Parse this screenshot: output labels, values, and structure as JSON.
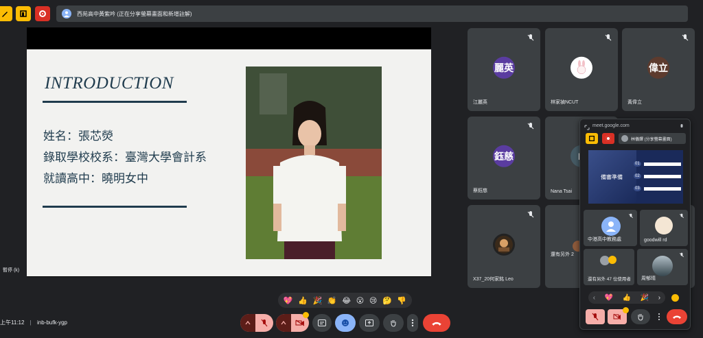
{
  "topbar": {
    "presenting_text": "西苑高中黃紫吟 (正在分享螢幕畫面和新增註解)"
  },
  "slide": {
    "title": "INTRODUCTION",
    "lines": [
      "姓名：張芯熒",
      "錄取學校校系：臺灣大學會計系",
      "就讀高中：曉明女中"
    ]
  },
  "tiles": [
    {
      "name": "江麗英",
      "avatar_text": "麗英",
      "avatar_color": "#5a3ca0"
    },
    {
      "name": "林家禎NCUT",
      "avatar_text": "",
      "avatar_color": "#ffffff"
    },
    {
      "name": "黃偉立",
      "avatar_text": "偉立",
      "avatar_color": "#5d3b2e"
    },
    {
      "name": "蔡鈺慈",
      "avatar_text": "鈺慈",
      "avatar_color": "#5a3ca0"
    },
    {
      "name": "Nana Tsai",
      "avatar_text": "N",
      "avatar_color": "#455a64"
    },
    {
      "name": "X37_20何家銘 Leo",
      "avatar_text": "",
      "avatar_color": "#222222"
    },
    {
      "name": "還有另外 2",
      "avatar_text": "",
      "avatar_color": "#8d5a3b"
    }
  ],
  "popup": {
    "url": "meet.google.com",
    "presenter": "林儀鐸 (分享螢幕畫面)",
    "preview_title": "備審準備",
    "preview_items": [
      "01",
      "02",
      "03"
    ],
    "mini_tiles": [
      {
        "name": "中港高中教務處"
      },
      {
        "name": "goodwill rd"
      },
      {
        "name": "還有另外 47 位使用者"
      },
      {
        "name": "周郁晴"
      }
    ],
    "reactions": [
      "💖",
      "👍",
      "🎉"
    ]
  },
  "reactions": [
    "💖",
    "👍",
    "🎉",
    "👏",
    "😂",
    "😮",
    "😢",
    "🤔",
    "👎"
  ],
  "bottom": {
    "time": "上午11:12",
    "separator": "|",
    "meeting_code": "inb-bufk-ygp",
    "side_label": "暫停 (k)"
  },
  "colors": {
    "accent_red": "#ea4335",
    "accent_yellow": "#fbbc04",
    "accent_blue": "#8ab4f8",
    "slide_text": "#1f3b4d"
  }
}
